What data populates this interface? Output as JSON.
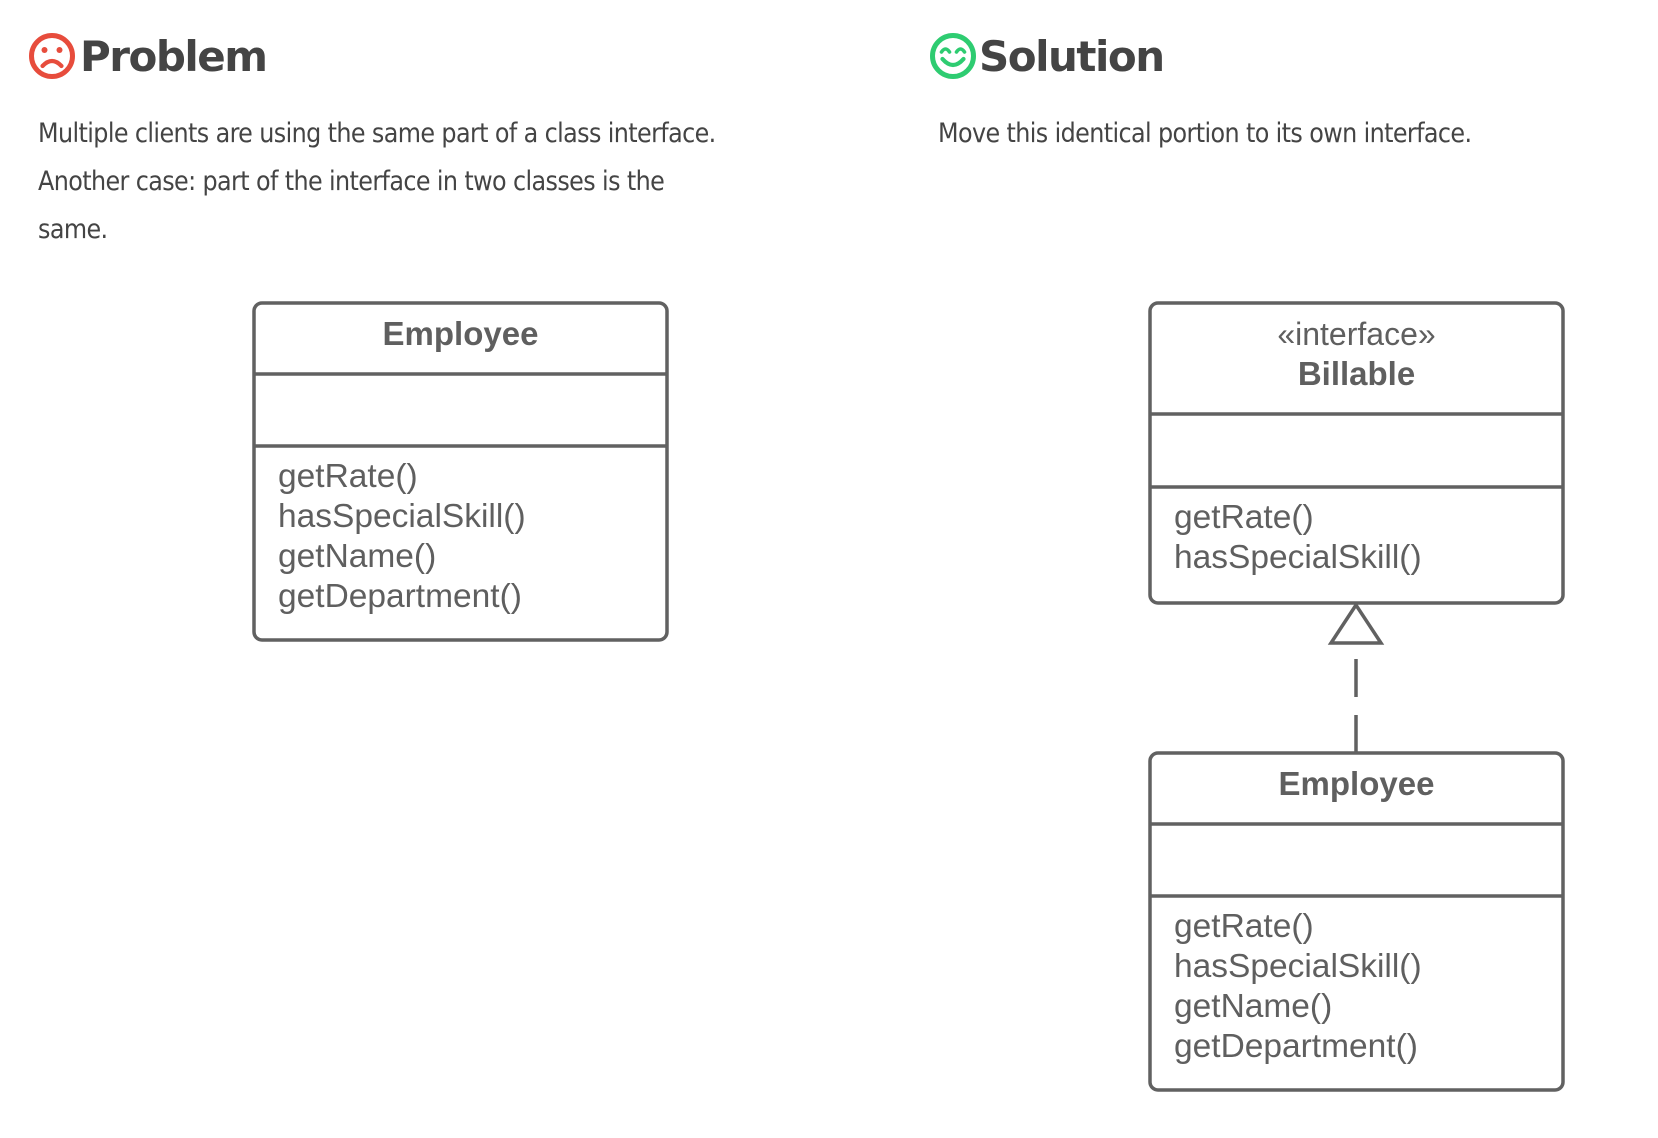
{
  "problem": {
    "icon": "sad-face-icon",
    "color": "#e74c3c",
    "title": "Problem",
    "description_lines": [
      "Multiple clients are using the same part of a class interface.",
      "Another case: part of the interface in two classes is the",
      "same."
    ],
    "diagram": {
      "class": {
        "name": "Employee",
        "attributes": [],
        "methods": [
          "getRate()",
          "hasSpecialSkill()",
          "getName()",
          "getDepartment()"
        ]
      }
    }
  },
  "solution": {
    "icon": "happy-face-icon",
    "color": "#2ecc71",
    "title": "Solution",
    "description_lines": [
      "Move this identical portion to its own interface."
    ],
    "diagram": {
      "interface": {
        "stereotype": "«interface»",
        "name": "Billable",
        "attributes": [],
        "methods": [
          "getRate()",
          "hasSpecialSkill()"
        ]
      },
      "class": {
        "name": "Employee",
        "attributes": [],
        "methods": [
          "getRate()",
          "hasSpecialSkill()",
          "getName()",
          "getDepartment()"
        ]
      },
      "relationship": {
        "type": "realization",
        "from": "Employee",
        "to": "Billable"
      }
    }
  },
  "colors": {
    "heading_text": "#444444",
    "diagram_stroke": "#616161",
    "diagram_text": "#5f5f5f"
  }
}
